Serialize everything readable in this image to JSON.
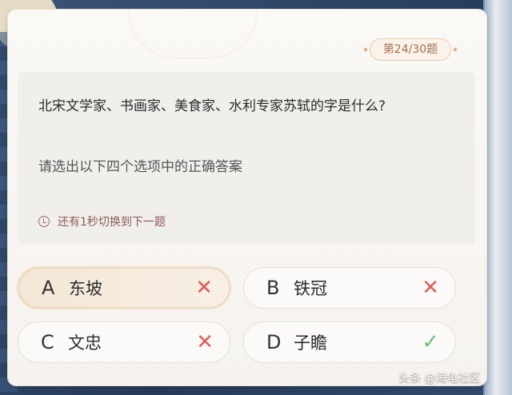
{
  "counter": "第24/30题",
  "question": "北宋文学家、书画家、美食家、水利专家苏轼的字是什么?",
  "hint": "请选出以下四个选项中的正确答案",
  "timer": "还有1秒切换到下一题",
  "options": [
    {
      "letter": "A",
      "text": "东坡",
      "mark": "✕",
      "status": "wrong-selected"
    },
    {
      "letter": "B",
      "text": "铁冠",
      "mark": "✕",
      "status": "wrong"
    },
    {
      "letter": "C",
      "text": "文忠",
      "mark": "✕",
      "status": "wrong"
    },
    {
      "letter": "D",
      "text": "子瞻",
      "mark": "✓",
      "status": "correct"
    }
  ],
  "watermark": "头条 @海龟社区",
  "colors": {
    "wrong": "#e05b5b",
    "correct": "#6cc07a",
    "counter_text": "#a5714f",
    "background": "#2f4668"
  }
}
